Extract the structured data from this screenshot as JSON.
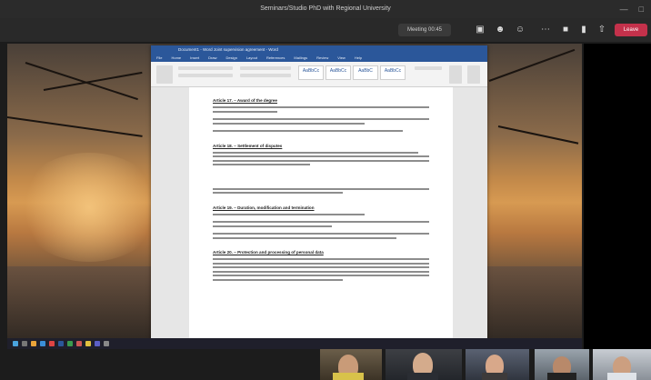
{
  "window": {
    "title": "Seminars/Studio PhD with Regional University"
  },
  "toolbar": {
    "time": "Meeting 00:45",
    "leave_label": "Leave"
  },
  "word": {
    "title": "Document1 - Word    Joint supervision agreement - Word",
    "tabs": [
      "File",
      "Home",
      "Insert",
      "Draw",
      "Design",
      "Layout",
      "References",
      "Mailings",
      "Review",
      "View",
      "Help"
    ],
    "styles": [
      "AaBbCc",
      "AaBbCc",
      "AaBbC",
      "AaBbCc"
    ]
  },
  "document": {
    "sections": [
      {
        "heading": "Article 17. – Award of the degree",
        "paragraphs": [
          2,
          2,
          1
        ]
      },
      {
        "heading": "Article 18. – Settlement of disputes",
        "paragraphs": [
          4,
          2
        ]
      },
      {
        "heading": "Article 19. – Duration, modification and termination",
        "paragraphs": [
          1,
          2,
          2
        ]
      },
      {
        "heading": "Article 20. – Protection and processing of personal data",
        "paragraphs": [
          6
        ]
      }
    ]
  },
  "colors": {
    "word_blue": "#2b579a",
    "leave_red": "#c4314b",
    "teams_bg": "#292929"
  }
}
